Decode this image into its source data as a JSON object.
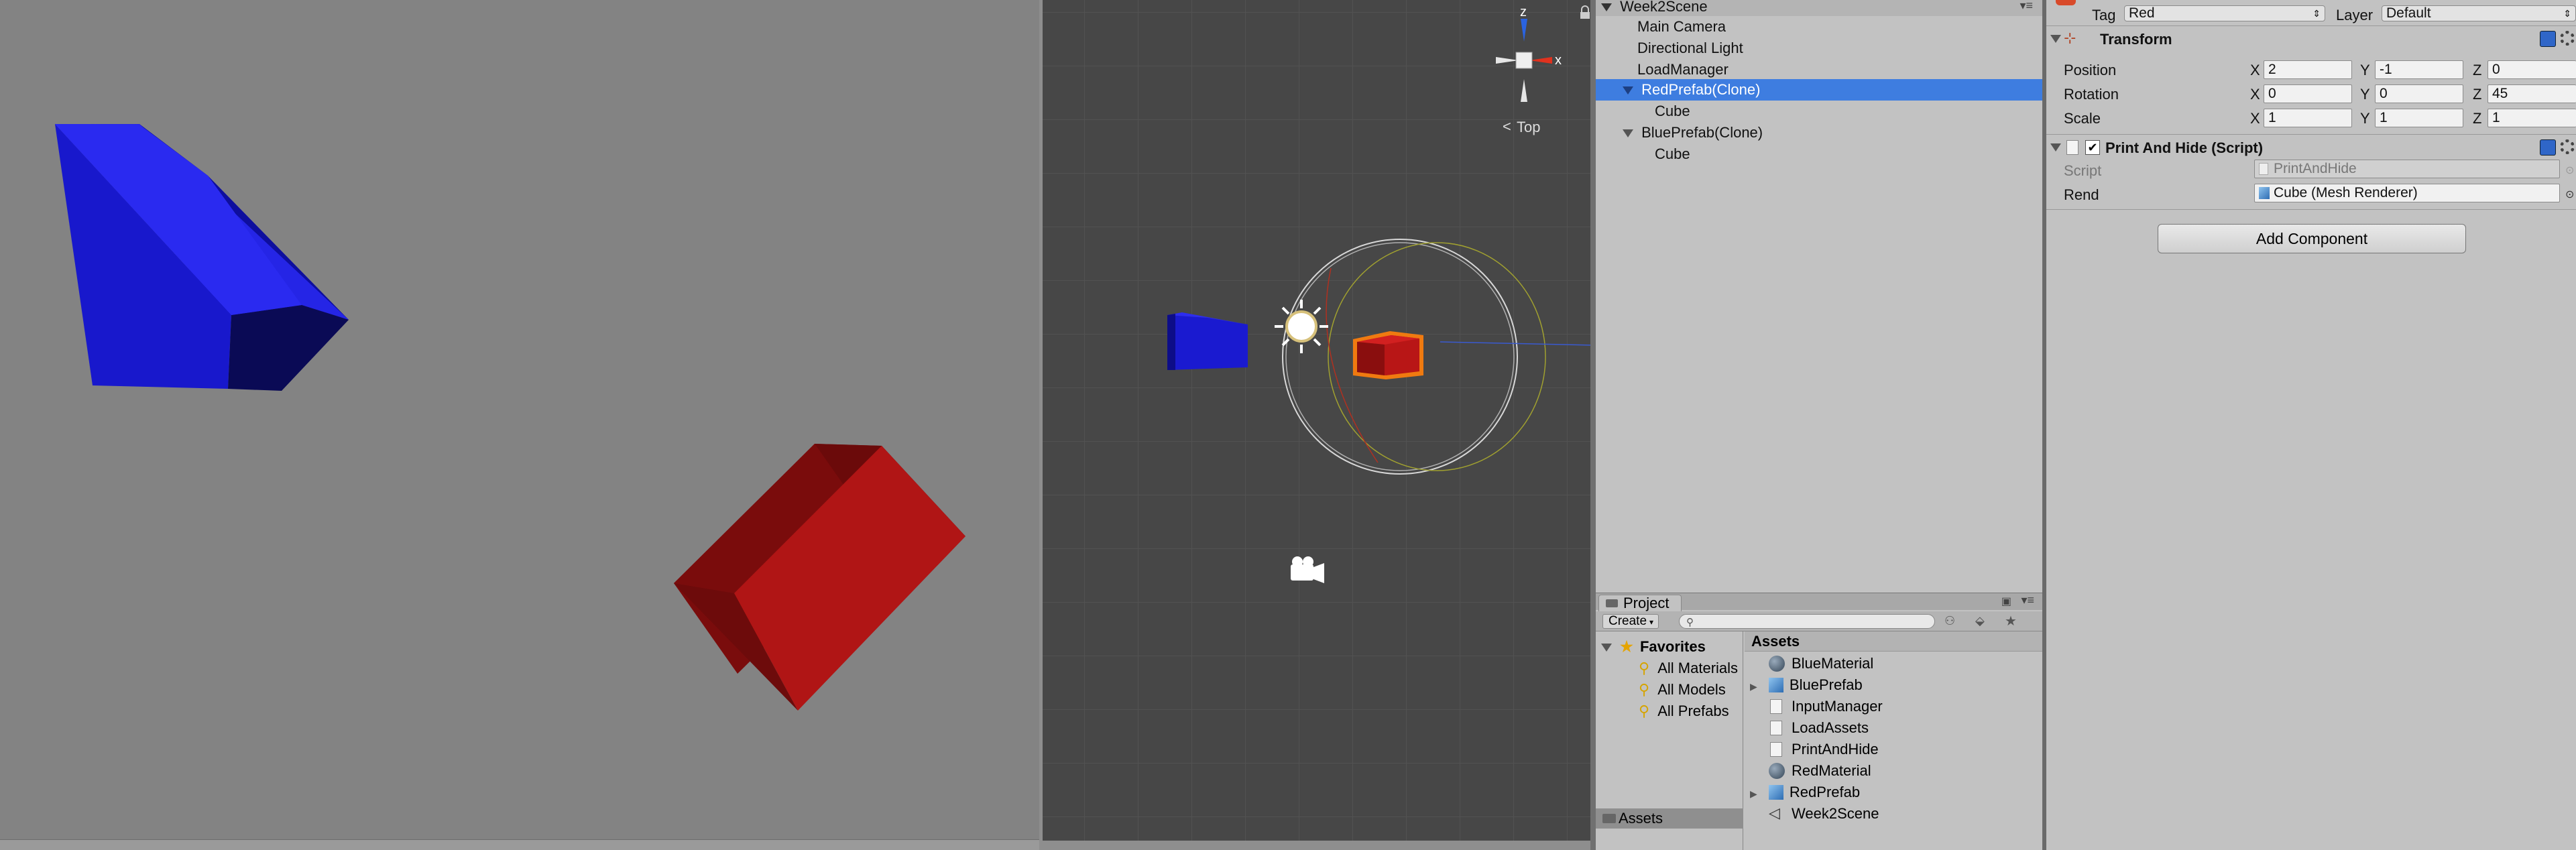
{
  "hierarchy": {
    "scene_name": "Week2Scene",
    "items": [
      {
        "label": "Main Camera"
      },
      {
        "label": "Directional Light"
      },
      {
        "label": "LoadManager"
      },
      {
        "label": "RedPrefab(Clone)"
      },
      {
        "label": "Cube"
      },
      {
        "label": "BluePrefab(Clone)"
      },
      {
        "label": "Cube"
      }
    ]
  },
  "scene_view": {
    "gizmo_z": "z",
    "gizmo_x": "x",
    "view_label": "Top"
  },
  "project": {
    "tab_label": "Project",
    "create_label": "Create",
    "favorites_label": "Favorites",
    "favorites": [
      "All Materials",
      "All Models",
      "All Prefabs"
    ],
    "assets_folder": "Assets",
    "assets_header": "Assets",
    "assets": [
      {
        "label": "BlueMaterial",
        "icon": "material-sphere-icon"
      },
      {
        "label": "BluePrefab",
        "icon": "prefab-cube-icon"
      },
      {
        "label": "InputManager",
        "icon": "script-icon"
      },
      {
        "label": "LoadAssets",
        "icon": "script-icon"
      },
      {
        "label": "PrintAndHide",
        "icon": "script-icon"
      },
      {
        "label": "RedMaterial",
        "icon": "material-sphere-icon"
      },
      {
        "label": "RedPrefab",
        "icon": "prefab-cube-icon"
      },
      {
        "label": "Week2Scene",
        "icon": "unity-scene-icon"
      }
    ]
  },
  "inspector": {
    "tag_label": "Tag",
    "tag_value": "Red",
    "layer_label": "Layer",
    "layer_value": "Default",
    "transform": {
      "title": "Transform",
      "position_label": "Position",
      "rotation_label": "Rotation",
      "scale_label": "Scale",
      "x_label": "X",
      "y_label": "Y",
      "z_label": "Z",
      "position": {
        "x": "2",
        "y": "-1",
        "z": "0"
      },
      "rotation": {
        "x": "0",
        "y": "0",
        "z": "45"
      },
      "scale": {
        "x": "1",
        "y": "1",
        "z": "1"
      }
    },
    "script_component": {
      "title": "Print And Hide (Script)",
      "script_label": "Script",
      "script_value": "PrintAndHide",
      "rend_label": "Rend",
      "rend_value": "Cube (Mesh Renderer)"
    },
    "add_component_label": "Add Component"
  },
  "colors": {
    "selection": "#3e7de0",
    "blue_cube": "#1a1ad6",
    "red_cube": "#b31212",
    "gizmo_red": "#e0321e",
    "gizmo_blue": "#2a63e0"
  }
}
